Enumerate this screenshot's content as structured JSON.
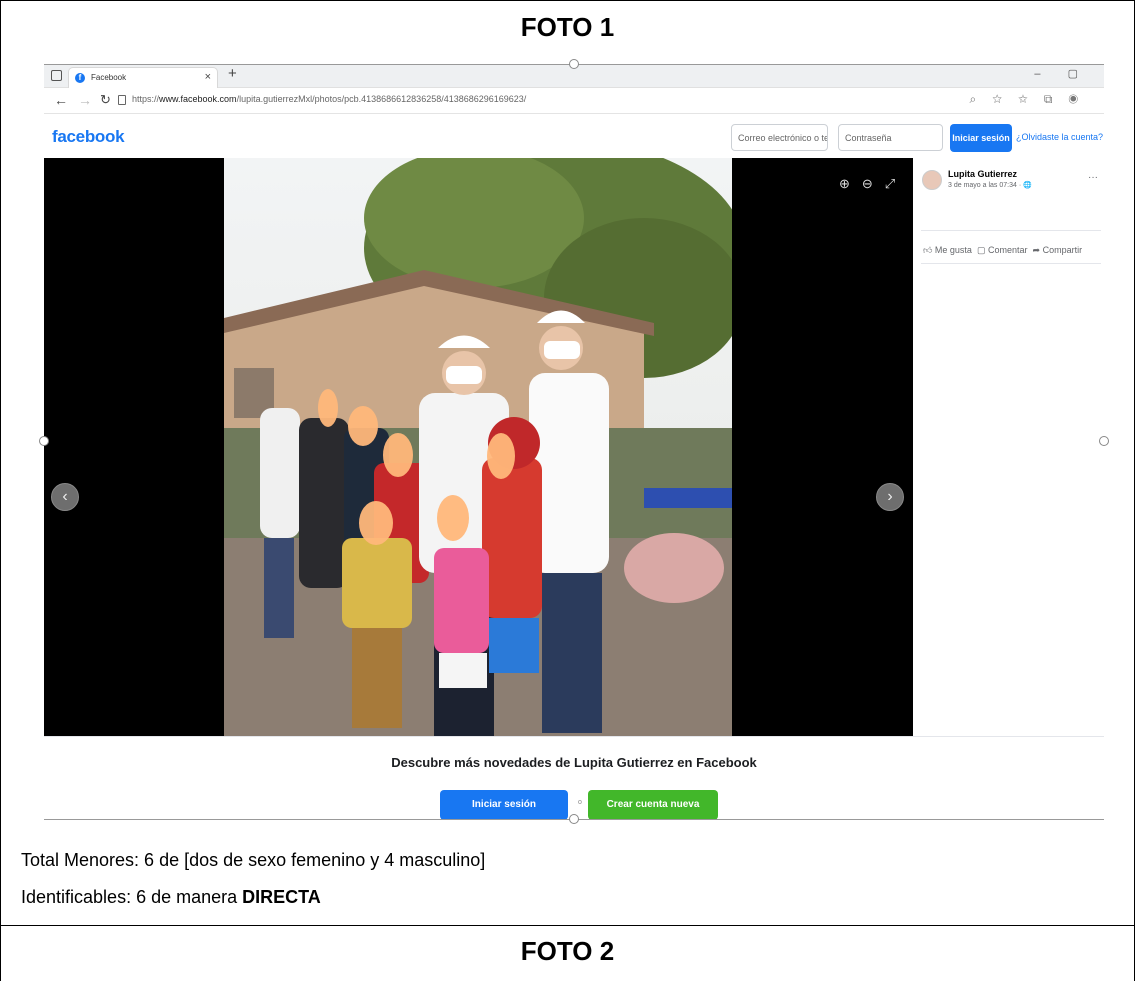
{
  "section1": {
    "title": "FOTO 1",
    "caption_line1": "Total Menores: 6 de [dos de sexo femenino y 4 masculino]",
    "caption_line2_prefix": "Identificables: 6 de manera ",
    "caption_line2_bold": "DIRECTA"
  },
  "section2": {
    "title": "FOTO 2"
  },
  "browser": {
    "tab_title": "Facebook",
    "tab_close": "×",
    "new_tab": "+",
    "window_controls": "–  ▢",
    "url_prefix": "https://",
    "url_host": "www.facebook.com",
    "url_path": "/lupita.gutierrezMxl/photos/pcb.4138686612836258/4138686296169623/"
  },
  "facebook": {
    "logo": "facebook",
    "email_placeholder": "Correo electrónico o telé",
    "password_placeholder": "Contraseña",
    "login_button": "Iniciar sesión",
    "forgot_link": "¿Olvidaste la cuenta?",
    "post_author": "Lupita Gutierrez",
    "post_time": "3 de mayo a las 07:34 · 🌐",
    "more": "···",
    "actions": {
      "like": "Me gusta",
      "comment": "Comentar",
      "share": "Compartir"
    },
    "discover_text": "Descubre más novedades de Lupita Gutierrez en Facebook",
    "login_big": "Iniciar sesión",
    "or": "o",
    "create_account": "Crear cuenta nueva"
  },
  "colors": {
    "facebook_blue": "#1877f2",
    "create_green": "#42b72a",
    "blur_face": "#ffb77a"
  }
}
